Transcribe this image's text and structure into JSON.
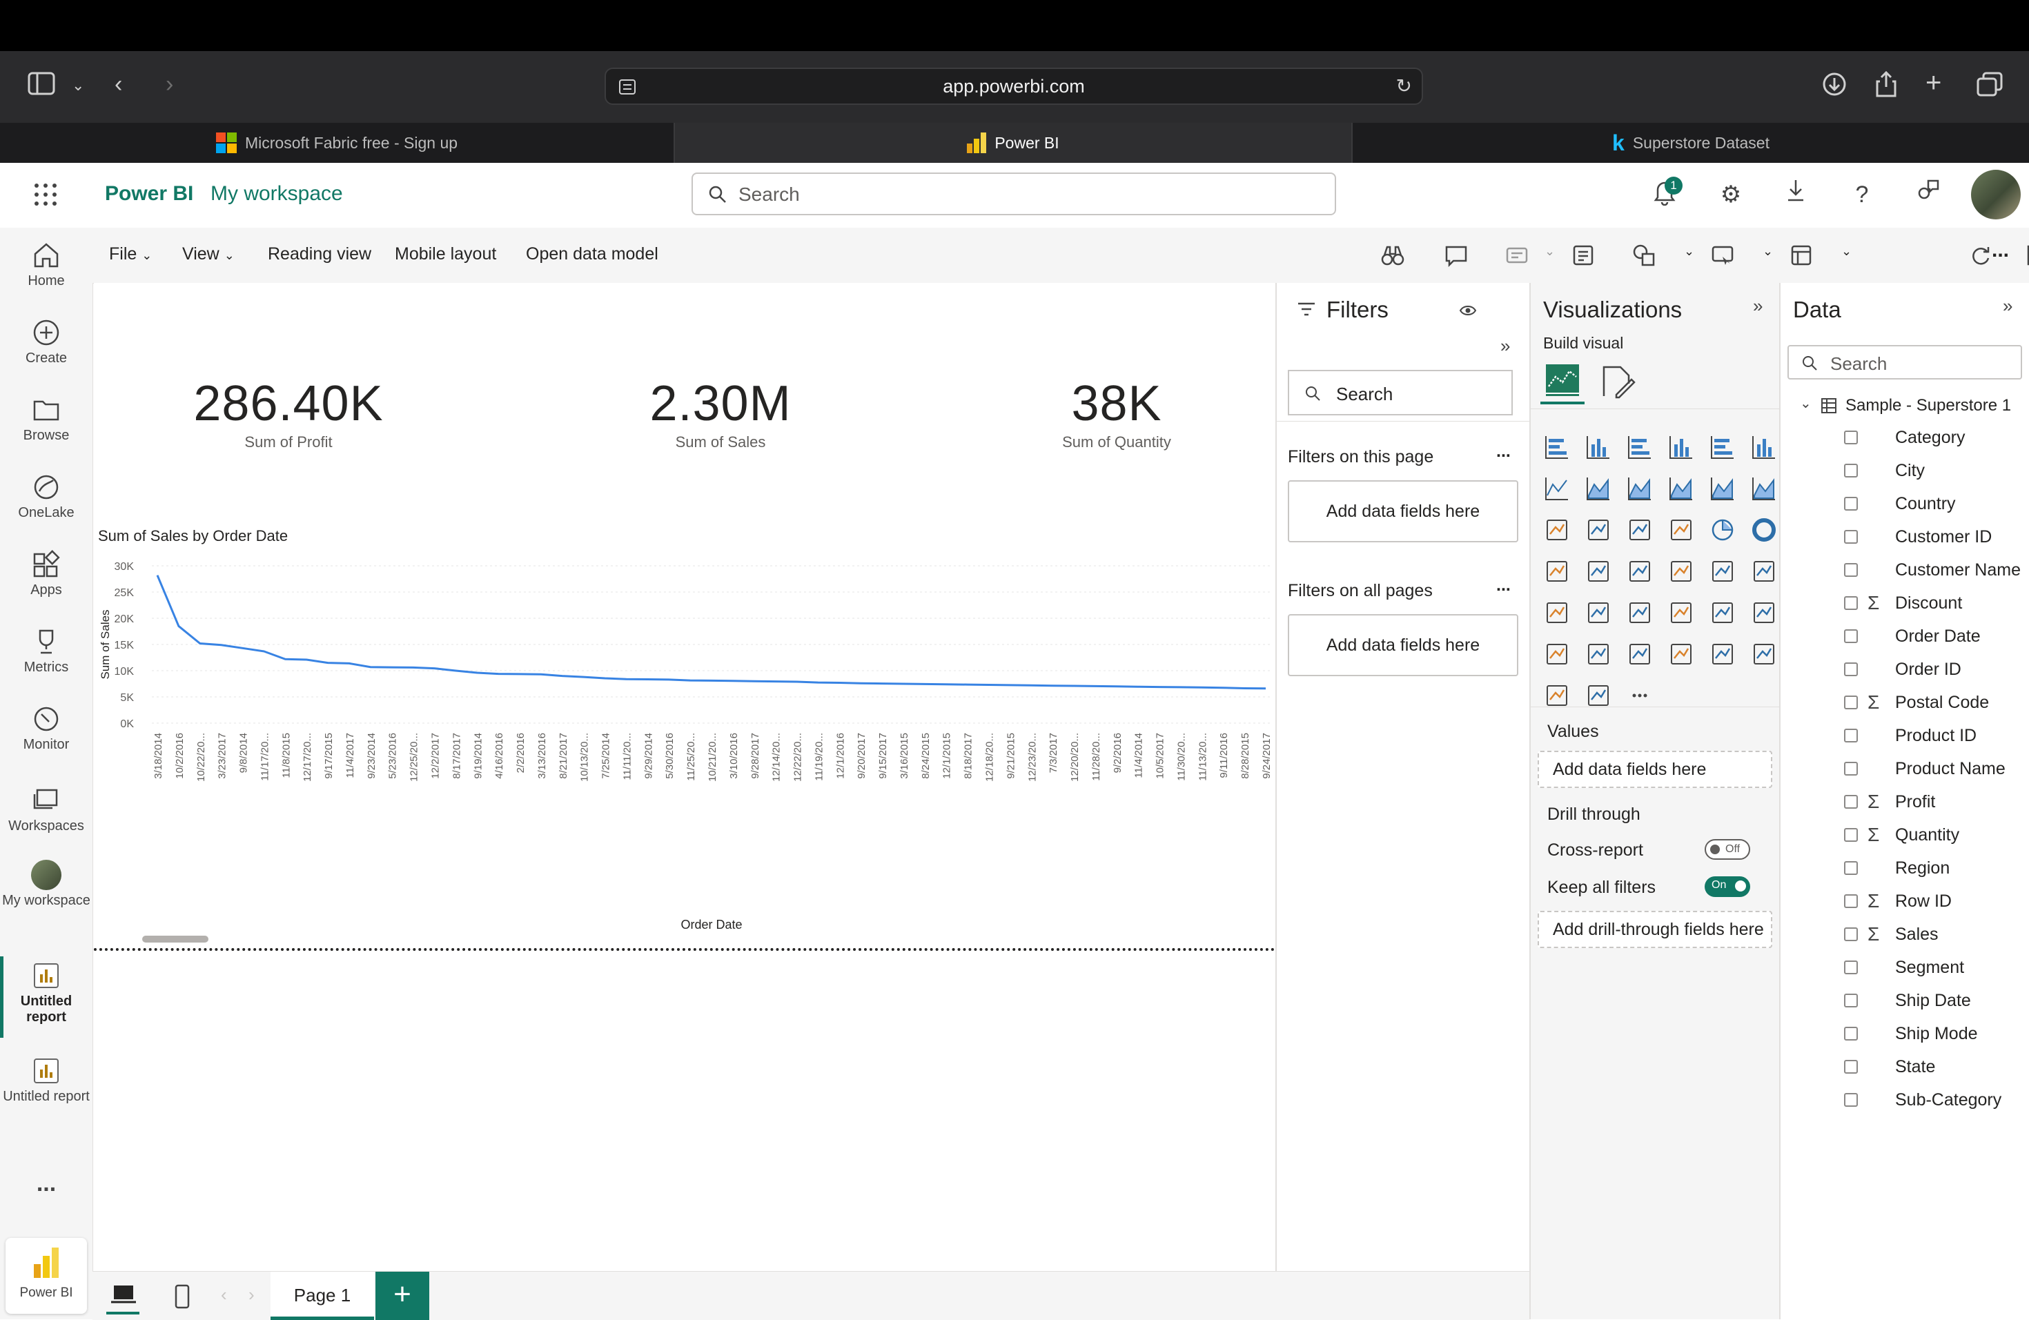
{
  "browser": {
    "url": "app.powerbi.com",
    "tabs": [
      {
        "label": "Microsoft Fabric free - Sign up"
      },
      {
        "label": "Power BI"
      },
      {
        "label": "Superstore Dataset"
      }
    ]
  },
  "header": {
    "app_title": "Power BI",
    "workspace": "My workspace",
    "search_placeholder": "Search",
    "notification_count": "1"
  },
  "left_nav": {
    "items": [
      {
        "label": "Home"
      },
      {
        "label": "Create"
      },
      {
        "label": "Browse"
      },
      {
        "label": "OneLake"
      },
      {
        "label": "Apps"
      },
      {
        "label": "Metrics"
      },
      {
        "label": "Monitor"
      },
      {
        "label": "Workspaces"
      },
      {
        "label": "My workspace"
      },
      {
        "label": "Untitled report"
      },
      {
        "label": "Untitled report"
      }
    ],
    "more": "...",
    "bottom_label": "Power BI"
  },
  "ribbon": {
    "file": "File",
    "view": "View",
    "reading_view": "Reading view",
    "mobile_layout": "Mobile layout",
    "open_data_model": "Open data model",
    "more": "..."
  },
  "cards": [
    {
      "value": "286.40K",
      "label": "Sum of Profit"
    },
    {
      "value": "2.30M",
      "label": "Sum of Sales"
    },
    {
      "value": "38K",
      "label": "Sum of Quantity"
    }
  ],
  "chart_data": {
    "type": "line",
    "title": "Sum of Sales by Order Date",
    "xlabel": "Order Date",
    "ylabel": "Sum of Sales",
    "ylim": [
      0,
      30000
    ],
    "y_ticks": [
      "0K",
      "5K",
      "10K",
      "15K",
      "20K",
      "25K",
      "30K"
    ],
    "grid": true,
    "color": "#3883e3",
    "categories": [
      "3/18/2014",
      "10/2/2016",
      "10/22/20...",
      "3/23/2017",
      "9/8/2014",
      "11/17/20...",
      "11/8/2015",
      "12/17/20...",
      "9/17/2015",
      "11/4/2017",
      "9/23/2014",
      "5/23/2016",
      "12/25/20...",
      "12/2/2017",
      "8/17/2017",
      "9/19/2014",
      "4/16/2016",
      "2/2/2016",
      "3/13/2016",
      "8/21/2017",
      "10/13/20...",
      "7/25/2014",
      "11/11/20...",
      "9/29/2014",
      "5/30/2016",
      "11/25/20...",
      "10/21/20...",
      "3/10/2016",
      "9/28/2017",
      "12/14/20...",
      "12/22/20...",
      "11/19/20...",
      "12/1/2016",
      "9/20/2017",
      "9/15/2017",
      "3/16/2015",
      "8/24/2015",
      "12/1/2015",
      "8/18/2017",
      "12/18/20...",
      "9/21/2015",
      "12/23/20...",
      "7/3/2017",
      "12/20/20...",
      "11/28/20...",
      "9/2/2016",
      "11/4/2014",
      "10/5/2017",
      "11/30/20...",
      "11/13/20...",
      "9/11/2016",
      "8/28/2015",
      "9/24/2017"
    ],
    "values": [
      28200,
      18500,
      15200,
      14900,
      14300,
      13700,
      12200,
      12100,
      11500,
      11400,
      10700,
      10650,
      10600,
      10450,
      10000,
      9600,
      9400,
      9350,
      9300,
      9000,
      8800,
      8550,
      8400,
      8350,
      8300,
      8150,
      8100,
      8050,
      8000,
      7950,
      7900,
      7750,
      7700,
      7600,
      7550,
      7500,
      7450,
      7400,
      7350,
      7300,
      7250,
      7200,
      7150,
      7100,
      7050,
      7000,
      6950,
      6900,
      6850,
      6800,
      6750,
      6650,
      6600
    ]
  },
  "filters": {
    "title": "Filters",
    "search_placeholder": "Search",
    "on_this_page": "Filters on this page",
    "on_all_pages": "Filters on all pages",
    "add_fields": "Add data fields here",
    "more": "..."
  },
  "visualizations": {
    "title": "Visualizations",
    "build_visual": "Build visual",
    "values_label": "Values",
    "values_well": "Add data fields here",
    "drill_through": "Drill through",
    "cross_report": "Cross-report",
    "cross_report_state": "Off",
    "keep_all_filters": "Keep all filters",
    "keep_all_filters_state": "On",
    "drill_well": "Add drill-through fields here",
    "more": "..."
  },
  "data_pane": {
    "title": "Data",
    "search_placeholder": "Search",
    "table_name": "Sample - Superstore 1",
    "fields": [
      {
        "name": "Category",
        "sigma": ""
      },
      {
        "name": "City",
        "sigma": ""
      },
      {
        "name": "Country",
        "sigma": ""
      },
      {
        "name": "Customer ID",
        "sigma": ""
      },
      {
        "name": "Customer Name",
        "sigma": ""
      },
      {
        "name": "Discount",
        "sigma": "Σ"
      },
      {
        "name": "Order Date",
        "sigma": ""
      },
      {
        "name": "Order ID",
        "sigma": ""
      },
      {
        "name": "Postal Code",
        "sigma": "Σ"
      },
      {
        "name": "Product ID",
        "sigma": ""
      },
      {
        "name": "Product Name",
        "sigma": ""
      },
      {
        "name": "Profit",
        "sigma": "Σ"
      },
      {
        "name": "Quantity",
        "sigma": "Σ"
      },
      {
        "name": "Region",
        "sigma": ""
      },
      {
        "name": "Row ID",
        "sigma": "Σ"
      },
      {
        "name": "Sales",
        "sigma": "Σ"
      },
      {
        "name": "Segment",
        "sigma": ""
      },
      {
        "name": "Ship Date",
        "sigma": ""
      },
      {
        "name": "Ship Mode",
        "sigma": ""
      },
      {
        "name": "State",
        "sigma": ""
      },
      {
        "name": "Sub-Category",
        "sigma": ""
      }
    ]
  },
  "bottom": {
    "page_tab": "Page 1",
    "add_page": "+"
  }
}
